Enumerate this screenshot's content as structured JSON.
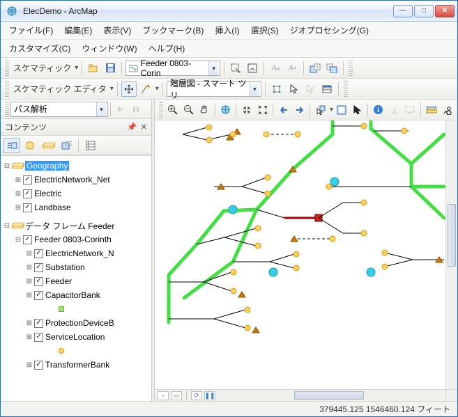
{
  "window": {
    "title": "ElecDemo - ArcMap"
  },
  "menu": {
    "row1": [
      "ファイル(F)",
      "編集(E)",
      "表示(V)",
      "ブックマーク(B)",
      "挿入(I)",
      "選択(S)",
      "ジオプロセシング(G)"
    ],
    "row2": [
      "カスタマイズ(C)",
      "ウィンドウ(W)",
      "ヘルプ(H)"
    ]
  },
  "toolbar1": {
    "schematic_label": "スケマティック",
    "combo_value": "Feeder 0803-Corin"
  },
  "toolbar2": {
    "editor_label": "スケマティック エディタ",
    "combo_value": "階層図 - スマート ツリ"
  },
  "left_combo": {
    "value": "パス解析"
  },
  "toc": {
    "title": "コンテンツ",
    "frames": [
      {
        "name": "Geography",
        "selected": true,
        "layers": [
          {
            "name": "ElectricNetwork_Net",
            "checked": true
          },
          {
            "name": "Electric",
            "checked": true
          },
          {
            "name": "Landbase",
            "checked": true
          }
        ]
      },
      {
        "name": "データ フレーム Feeder",
        "selected": false,
        "layers": [
          {
            "name": "Feeder 0803-Corinth",
            "checked": true,
            "children": [
              {
                "name": "ElectricNetwork_N",
                "checked": true
              },
              {
                "name": "Substation",
                "checked": true
              },
              {
                "name": "Feeder",
                "checked": true
              },
              {
                "name": "CapacitorBank",
                "checked": true,
                "symbol": "square"
              },
              {
                "name": "ProtectionDeviceB",
                "checked": true
              },
              {
                "name": "ServiceLocation",
                "checked": true,
                "symbol": "dot"
              },
              {
                "name": "TransformerBank",
                "checked": true
              }
            ]
          }
        ]
      }
    ]
  },
  "status": {
    "coords": "379445.125 1546460.124 フィート"
  },
  "icons": {
    "app": "globe",
    "minimize": "—",
    "maximize": "□",
    "close": "✕"
  }
}
